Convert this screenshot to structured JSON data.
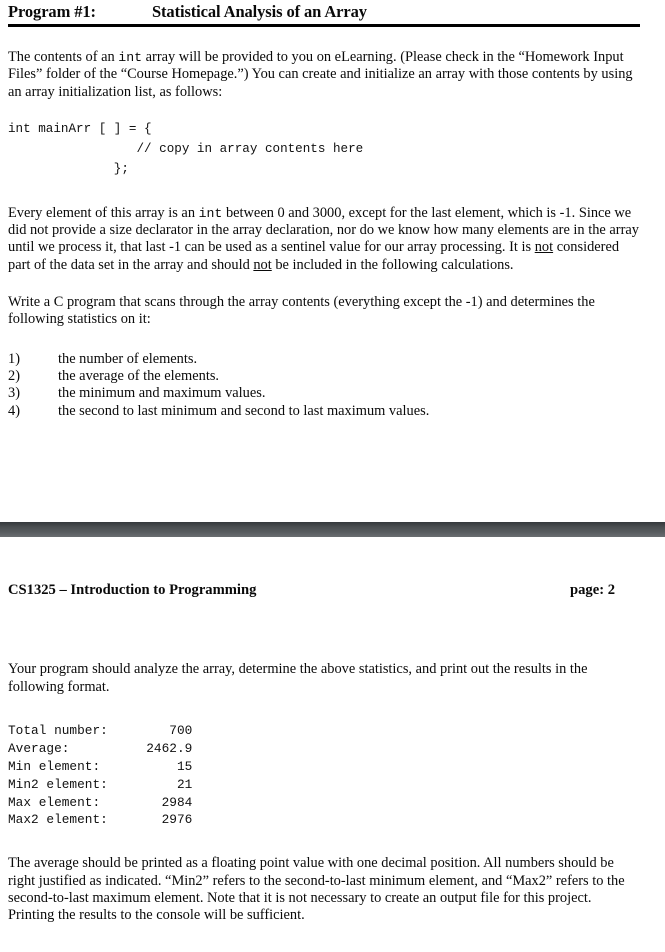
{
  "document": {
    "title_label": "Program #1:",
    "title_main": "Statistical Analysis of an Array"
  },
  "page1": {
    "intro_paragraph_part1": "The contents of an ",
    "intro_inline_code": "int",
    "intro_paragraph_part2": " array will be provided to you on eLearning.  (Please check in the “Homework Input Files” folder of the “Course Homepage.”)  You can create and initialize an array with those contents by using an array initialization list, as follows:",
    "code_block": "int mainArr [ ] = {\n                 // copy in array contents here\n              };",
    "para2_part1": "Every element of this array is an ",
    "para2_inline_code": "int",
    "para2_part2": " between 0 and 3000, except for the last element, which is -1.  Since we did not provide a size declarator in the array declaration, nor do we know how many elements are in the array until we process it, that last -1 can be used as a sentinel value for our array processing.  It is ",
    "para2_underline1": "not",
    "para2_part3": " considered part of the data set in the array and should ",
    "para2_underline2": "not",
    "para2_part4": " be included in the following calculations.",
    "para3": "Write a C program that scans through the array contents (everything except the -1) and determines the following statistics on it:",
    "stats_list": [
      {
        "num": "1)",
        "text": "the number of elements."
      },
      {
        "num": "2)",
        "text": "the average of the elements."
      },
      {
        "num": "3)",
        "text": "the minimum and maximum values."
      },
      {
        "num": "4)",
        "text": "the second to last minimum and second to last maximum values."
      }
    ]
  },
  "page2": {
    "header_left": "CS1325 – Introduction to Programming",
    "header_right": "page:  2",
    "para1": "Your program should analyze the array, determine the above statistics, and print out the results in the following format.",
    "output_block": "Total number:        700\nAverage:          2462.9\nMin element:          15\nMin2 element:         21\nMax element:        2984\nMax2 element:       2976",
    "output_rows": [
      {
        "label": "Total number:",
        "value": "700"
      },
      {
        "label": "Average:",
        "value": "2462.9"
      },
      {
        "label": "Min element:",
        "value": "15"
      },
      {
        "label": "Min2 element:",
        "value": "21"
      },
      {
        "label": "Max element:",
        "value": "2984"
      },
      {
        "label": "Max2 element:",
        "value": "2976"
      }
    ],
    "para2": "The average should be printed as a floating point value with one decimal position.  All numbers should be right justified as indicated.  “Min2” refers to the second-to-last minimum element, and “Max2” refers to the second-to-last maximum element.  Note that it is not necessary to create an output file for this project.  Printing the results to the console will be sufficient."
  },
  "colors": {
    "text": "#0a0a0a",
    "rule": "#000000",
    "band_dark": "#34383b",
    "band_light": "#6a6e71",
    "background": "#ffffff"
  }
}
